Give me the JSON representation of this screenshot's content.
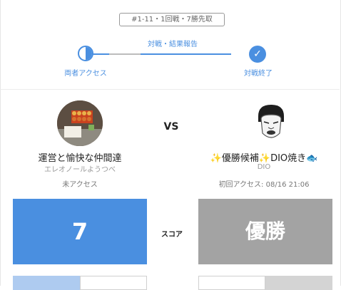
{
  "match": {
    "round_badge": "#1-11・1回戦・7勝先取",
    "step_title": "対戦・結果報告",
    "step_left_label": "両者アクセス",
    "step_right_label": "対戦終了",
    "vs": "VS"
  },
  "player_left": {
    "name": "運営と愉快な仲間達",
    "subname": "エレオノールようつべ",
    "status": "未アクセス",
    "score": "7"
  },
  "player_right": {
    "name_prefix": "✨",
    "name_main": "優勝候補",
    "name_mid": "✨",
    "name_tail": "DIO焼き",
    "name_suffix": "🐟",
    "subname": "DIO",
    "status": "初回アクセス: 08/16 21:06",
    "score": "優勝"
  },
  "score_label": "スコア",
  "colors": {
    "accent": "#4a8fe0",
    "winner_box": "#4a8fe0",
    "loser_box": "#a3a3a3"
  }
}
